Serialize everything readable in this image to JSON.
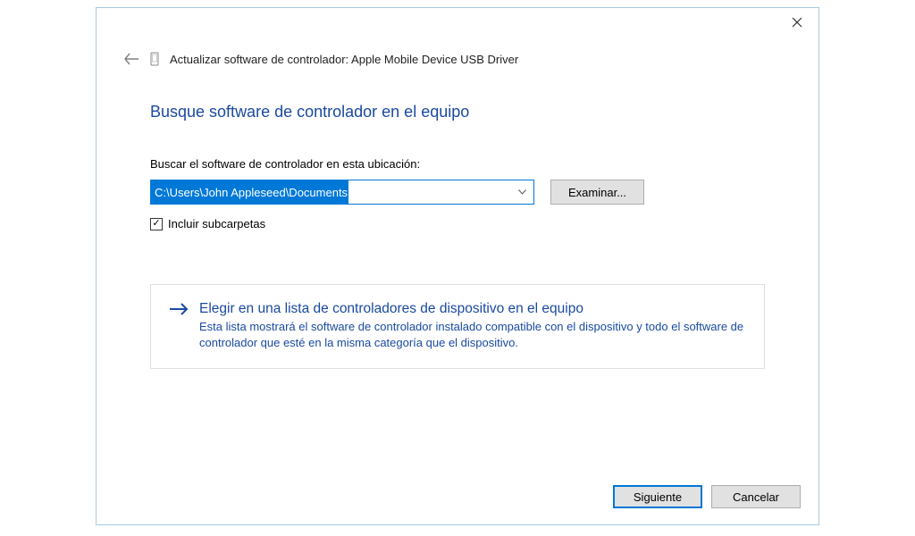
{
  "header": {
    "title": "Actualizar software de controlador: Apple Mobile Device USB Driver"
  },
  "main": {
    "heading": "Busque software de controlador en el equipo",
    "path_label": "Buscar el software de controlador en esta ubicación:",
    "path_value": "C:\\Users\\John Appleseed\\Documents",
    "browse_label": "Examinar...",
    "checkbox_label": "Incluir subcarpetas",
    "checkbox_checked": "✓"
  },
  "option": {
    "title": "Elegir en una lista de controladores de dispositivo en el equipo",
    "desc": "Esta lista mostrará el software de controlador instalado compatible con el dispositivo y todo el software de controlador que esté en la misma categoría que el dispositivo."
  },
  "footer": {
    "next_label": "Siguiente",
    "cancel_label": "Cancelar"
  }
}
